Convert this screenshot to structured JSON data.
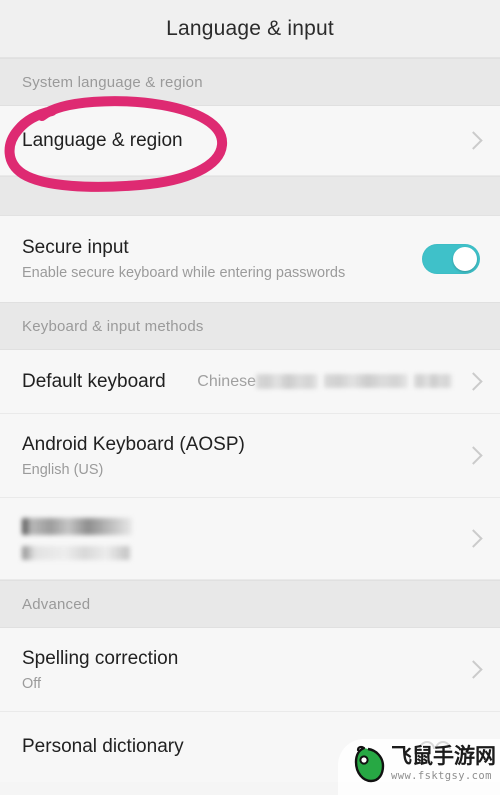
{
  "header": {
    "title": "Language & input"
  },
  "sections": [
    {
      "id": "system-language-region",
      "header": "System language & region",
      "rows": [
        {
          "id": "language-region",
          "title": "Language & region",
          "sub": "",
          "value": "",
          "accessory": "chevron",
          "annotated": true
        }
      ]
    },
    {
      "id": "secure-input",
      "header": "",
      "rows": [
        {
          "id": "secure-input",
          "title": "Secure input",
          "sub": "Enable secure keyboard while entering passwords",
          "value": "",
          "accessory": "toggle",
          "toggle_on": true
        }
      ]
    },
    {
      "id": "keyboard-input-methods",
      "header": "Keyboard & input methods",
      "rows": [
        {
          "id": "default-keyboard",
          "title": "Default keyboard",
          "sub": "",
          "value": "Chinese",
          "value_redacted": true,
          "accessory": "chevron"
        },
        {
          "id": "android-keyboard-aosp",
          "title": "Android Keyboard (AOSP)",
          "sub": "English (US)",
          "value": "",
          "accessory": "chevron"
        },
        {
          "id": "redacted-keyboard",
          "title": "",
          "title_redacted": true,
          "sub": "",
          "sub_redacted": true,
          "value": "",
          "accessory": "chevron"
        }
      ]
    },
    {
      "id": "advanced",
      "header": "Advanced",
      "rows": [
        {
          "id": "spelling-correction",
          "title": "Spelling correction",
          "sub": "Off",
          "value": "",
          "accessory": "chevron"
        },
        {
          "id": "personal-dictionary",
          "title": "Personal dictionary",
          "sub": "",
          "value": "",
          "accessory": "none"
        }
      ]
    }
  ],
  "annotation": {
    "shape": "hand-drawn-ellipse",
    "color": "#de2a72",
    "targets": "language-region"
  },
  "watermark": {
    "site_name": "飞鼠手游网",
    "url": "www.fsktgsy.com",
    "logo": "mouse-icon",
    "logo_color": "#27a844"
  },
  "colors": {
    "page_bg": "#f5f5f5",
    "titlebar_bg": "#f0f0f0",
    "row_bg": "#f7f7f7",
    "section_header_bg": "#e8e8e8",
    "divider": "#eaeaea",
    "title_text": "#212121",
    "secondary_text": "#9b9b9b",
    "toggle_on": "#3fc1c9",
    "chevron": "#c4c4c4",
    "annotation_pink": "#de2a72"
  }
}
